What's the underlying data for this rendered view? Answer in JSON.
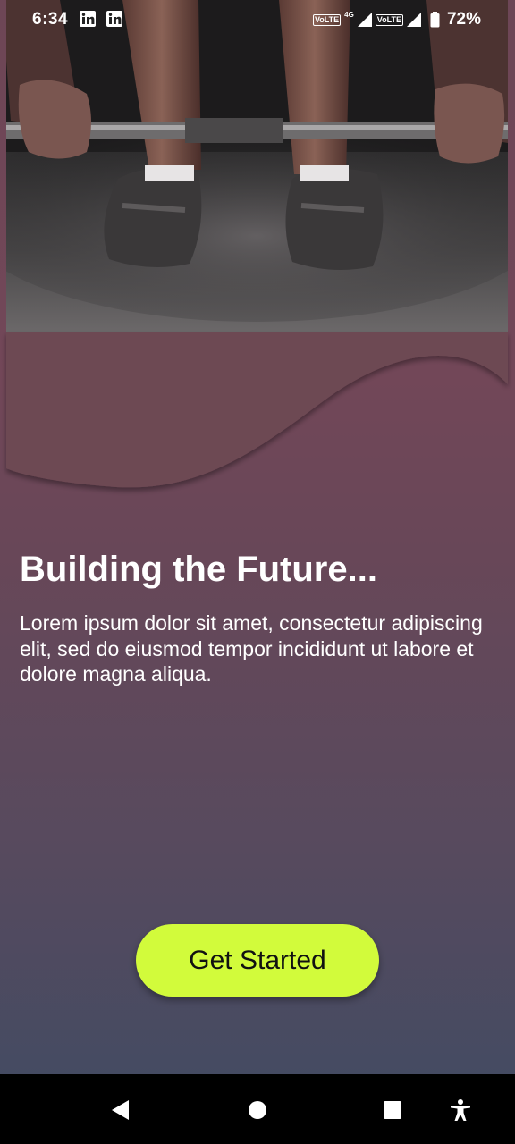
{
  "status_bar": {
    "time": "6:34",
    "notification_icons": [
      "linkedin-icon",
      "linkedin-icon"
    ],
    "network_labels": [
      "VoLTE",
      "VoLTE"
    ],
    "network_badge": "4G",
    "battery": "72%"
  },
  "hero": {
    "image_description": "weightlifter-gripping-barbell"
  },
  "content": {
    "title": "Building the Future...",
    "description": "Lorem ipsum dolor sit amet, consectetur adipiscing elit, sed do eiusmod tempor incididunt ut labore et dolore magna aliqua."
  },
  "cta": {
    "label": "Get Started",
    "color": "#d2fb3b"
  },
  "nav_bar": {
    "icons": [
      "back-icon",
      "home-icon",
      "recents-icon",
      "accessibility-icon"
    ]
  },
  "colors": {
    "background_top": "#724758",
    "background_bottom": "#454b62",
    "text": "#ffffff"
  }
}
